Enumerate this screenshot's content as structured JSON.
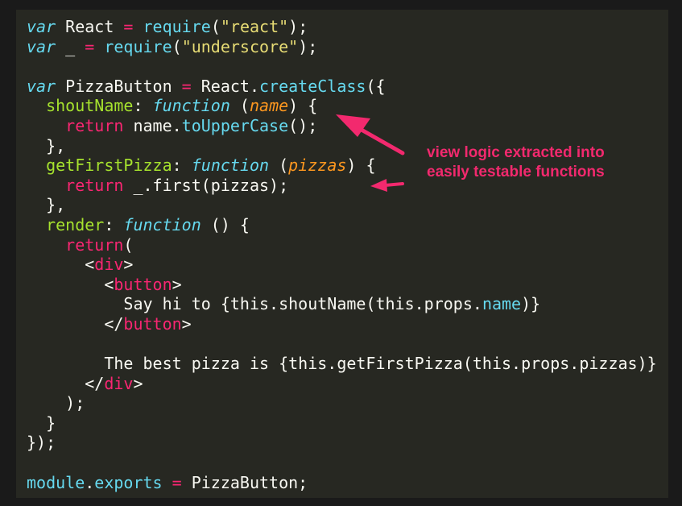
{
  "code_lines": [
    [
      {
        "t": "var",
        "c": "kw-storage"
      },
      {
        "t": " React ",
        "c": "plain"
      },
      {
        "t": "=",
        "c": "kw-op"
      },
      {
        "t": " ",
        "c": "plain"
      },
      {
        "t": "require",
        "c": "fn-call"
      },
      {
        "t": "(",
        "c": "plain"
      },
      {
        "t": "\"react\"",
        "c": "str"
      },
      {
        "t": ");",
        "c": "plain"
      }
    ],
    [
      {
        "t": "var",
        "c": "kw-storage"
      },
      {
        "t": " _ ",
        "c": "plain"
      },
      {
        "t": "=",
        "c": "kw-op"
      },
      {
        "t": " ",
        "c": "plain"
      },
      {
        "t": "require",
        "c": "fn-call"
      },
      {
        "t": "(",
        "c": "plain"
      },
      {
        "t": "\"underscore\"",
        "c": "str"
      },
      {
        "t": ");",
        "c": "plain"
      }
    ],
    [],
    [
      {
        "t": "var",
        "c": "kw-storage"
      },
      {
        "t": " PizzaButton ",
        "c": "plain"
      },
      {
        "t": "=",
        "c": "kw-op"
      },
      {
        "t": " React.",
        "c": "plain"
      },
      {
        "t": "createClass",
        "c": "fn-call"
      },
      {
        "t": "({",
        "c": "plain"
      }
    ],
    [
      {
        "t": "  ",
        "c": "plain"
      },
      {
        "t": "shoutName",
        "c": "prop-key"
      },
      {
        "t": ": ",
        "c": "plain"
      },
      {
        "t": "function",
        "c": "kw-storage"
      },
      {
        "t": " (",
        "c": "plain"
      },
      {
        "t": "name",
        "c": "param"
      },
      {
        "t": ") {",
        "c": "plain"
      }
    ],
    [
      {
        "t": "    ",
        "c": "plain"
      },
      {
        "t": "return",
        "c": "kw-return"
      },
      {
        "t": " name.",
        "c": "plain"
      },
      {
        "t": "toUpperCase",
        "c": "fn-call"
      },
      {
        "t": "();",
        "c": "plain"
      }
    ],
    [
      {
        "t": "  },",
        "c": "plain"
      }
    ],
    [
      {
        "t": "  ",
        "c": "plain"
      },
      {
        "t": "getFirstPizza",
        "c": "prop-key"
      },
      {
        "t": ": ",
        "c": "plain"
      },
      {
        "t": "function",
        "c": "kw-storage"
      },
      {
        "t": " (",
        "c": "plain"
      },
      {
        "t": "pizzas",
        "c": "param"
      },
      {
        "t": ") {",
        "c": "plain"
      }
    ],
    [
      {
        "t": "    ",
        "c": "plain"
      },
      {
        "t": "return",
        "c": "kw-return"
      },
      {
        "t": " _.first(pizzas);",
        "c": "plain"
      }
    ],
    [
      {
        "t": "  },",
        "c": "plain"
      }
    ],
    [
      {
        "t": "  ",
        "c": "plain"
      },
      {
        "t": "render",
        "c": "prop-key"
      },
      {
        "t": ": ",
        "c": "plain"
      },
      {
        "t": "function",
        "c": "kw-storage"
      },
      {
        "t": " () {",
        "c": "plain"
      }
    ],
    [
      {
        "t": "    ",
        "c": "plain"
      },
      {
        "t": "return",
        "c": "kw-return"
      },
      {
        "t": "(",
        "c": "plain"
      }
    ],
    [
      {
        "t": "      <",
        "c": "plain"
      },
      {
        "t": "div",
        "c": "tag"
      },
      {
        "t": ">",
        "c": "plain"
      }
    ],
    [
      {
        "t": "        <",
        "c": "plain"
      },
      {
        "t": "button",
        "c": "tag"
      },
      {
        "t": ">",
        "c": "plain"
      }
    ],
    [
      {
        "t": "          Say hi to {this.shoutName(this.props.",
        "c": "plain"
      },
      {
        "t": "name",
        "c": "fn-call"
      },
      {
        "t": ")}",
        "c": "plain"
      }
    ],
    [
      {
        "t": "        </",
        "c": "plain"
      },
      {
        "t": "button",
        "c": "tag"
      },
      {
        "t": ">",
        "c": "plain"
      }
    ],
    [],
    [
      {
        "t": "        The best pizza is {this.getFirstPizza(this.props.pizzas)}",
        "c": "plain"
      }
    ],
    [
      {
        "t": "      </",
        "c": "plain"
      },
      {
        "t": "div",
        "c": "tag"
      },
      {
        "t": ">",
        "c": "plain"
      }
    ],
    [
      {
        "t": "    );",
        "c": "plain"
      }
    ],
    [
      {
        "t": "  }",
        "c": "plain"
      }
    ],
    [
      {
        "t": "});",
        "c": "plain"
      }
    ],
    [],
    [
      {
        "t": "module",
        "c": "fn-call"
      },
      {
        "t": ".",
        "c": "plain"
      },
      {
        "t": "exports",
        "c": "fn-call"
      },
      {
        "t": " ",
        "c": "plain"
      },
      {
        "t": "=",
        "c": "kw-op"
      },
      {
        "t": " PizzaButton;",
        "c": "plain"
      }
    ]
  ],
  "annotation": {
    "line1": "view logic extracted into",
    "line2": "easily testable functions"
  },
  "colors": {
    "background": "#272822",
    "annotation": "#f2296e"
  }
}
